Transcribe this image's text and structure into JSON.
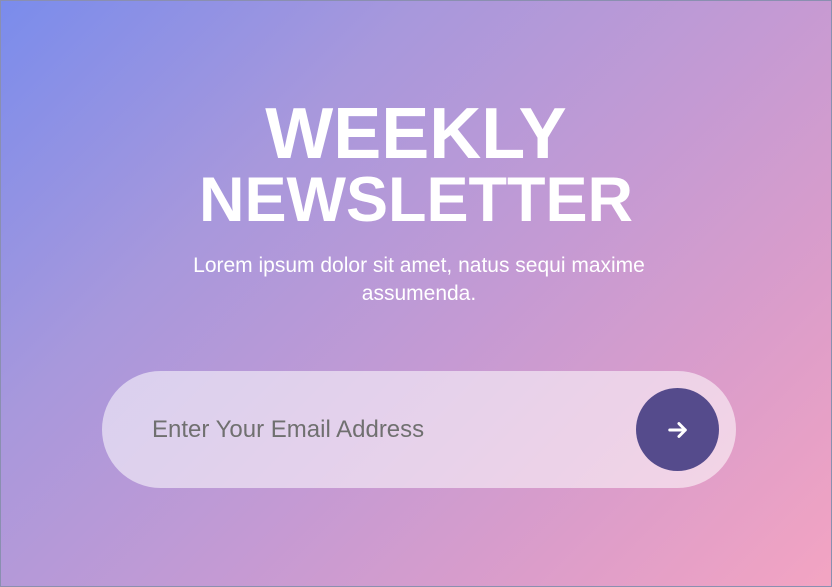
{
  "newsletter": {
    "title_line_1": "WEEKLY",
    "title_line_2": "NEWSLETTER",
    "description": "Lorem ipsum dolor sit amet, natus sequi maxime assumenda.",
    "email_placeholder": "Enter Your Email Address",
    "submit_icon": "arrow-right-icon"
  },
  "colors": {
    "button": "#554b8c",
    "text": "#ffffff"
  }
}
